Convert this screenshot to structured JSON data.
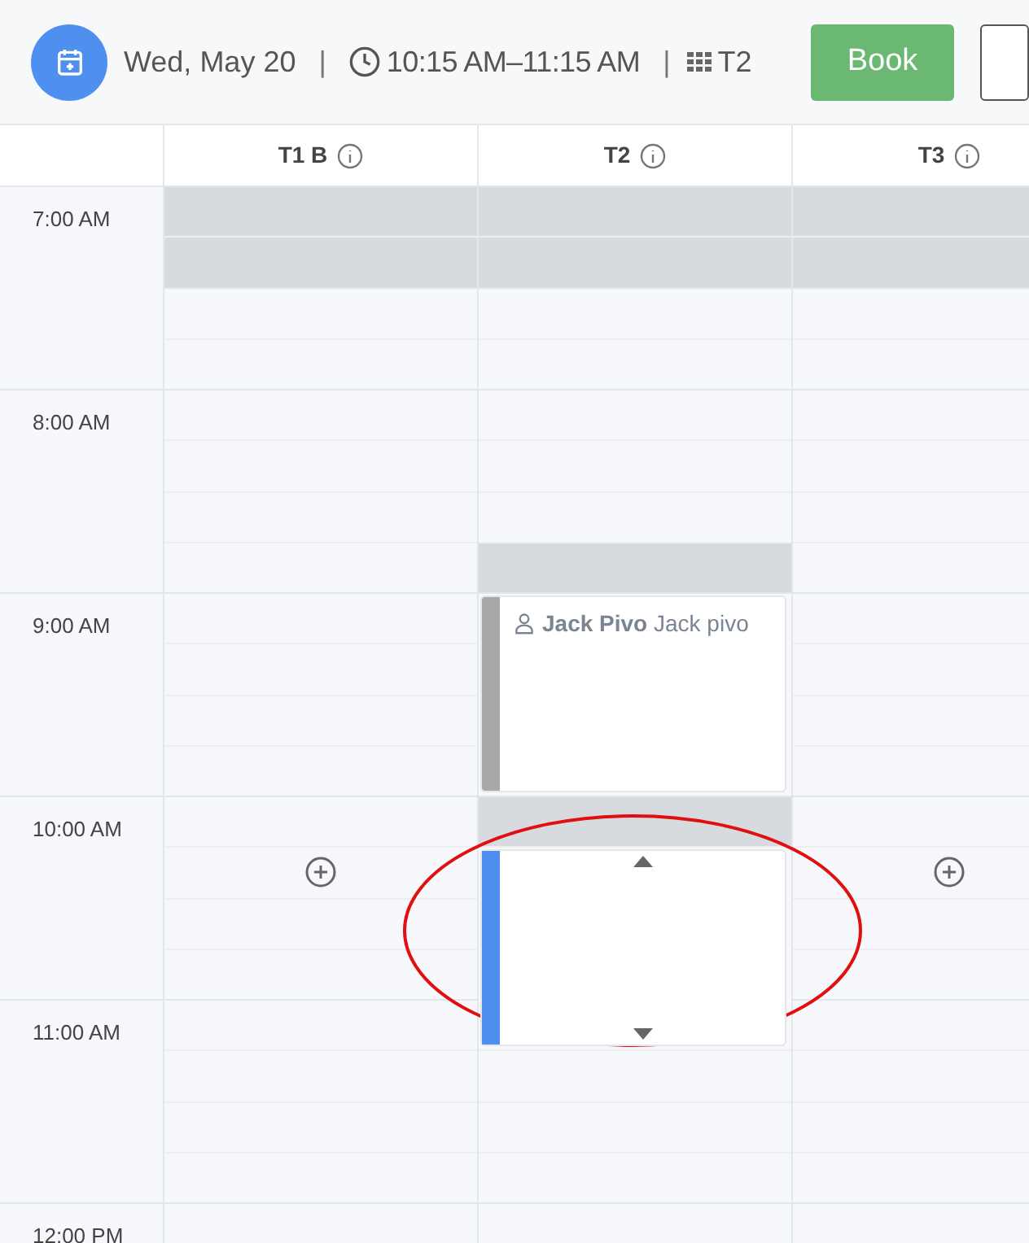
{
  "header": {
    "date": "Wed, May 20",
    "separator_1": "|",
    "time_range": "10:15 AM–11:15 AM",
    "separator_2": "|",
    "table": "T2",
    "book_button": "Book"
  },
  "hours": [
    "7:00 AM",
    "8:00 AM",
    "9:00 AM",
    "10:00 AM",
    "11:00 AM",
    "12:00 PM"
  ],
  "columns": [
    {
      "name": "T1 B",
      "slots": [
        {
          "kind": "blocked"
        },
        {
          "kind": "blocked"
        },
        {
          "kind": "free"
        },
        {
          "kind": "free"
        },
        {
          "kind": "free"
        },
        {
          "kind": "free"
        },
        {
          "kind": "free"
        },
        {
          "kind": "free"
        },
        {
          "kind": "free"
        },
        {
          "kind": "free"
        },
        {
          "kind": "free"
        },
        {
          "kind": "free"
        },
        {
          "kind": "free"
        },
        {
          "kind": "add"
        },
        {
          "kind": "free"
        },
        {
          "kind": "free"
        },
        {
          "kind": "free"
        },
        {
          "kind": "free"
        },
        {
          "kind": "free"
        },
        {
          "kind": "free"
        },
        {
          "kind": "free"
        }
      ]
    },
    {
      "name": "T2",
      "slots": [
        {
          "kind": "blocked"
        },
        {
          "kind": "blocked"
        },
        {
          "kind": "free"
        },
        {
          "kind": "free"
        },
        {
          "kind": "free"
        },
        {
          "kind": "free"
        },
        {
          "kind": "free"
        },
        {
          "kind": "blocked"
        },
        {
          "kind": "booked",
          "text": "**Jack Pivo** Jack pivo"
        },
        {
          "kind": "blocked"
        },
        {
          "kind": "new"
        },
        {
          "kind": "free"
        },
        {
          "kind": "free"
        },
        {
          "kind": "free"
        },
        {
          "kind": "free"
        }
      ]
    },
    {
      "name": "T3",
      "slots": [
        {
          "kind": "blocked"
        },
        {
          "kind": "blocked"
        },
        {
          "kind": "free"
        },
        {
          "kind": "free"
        },
        {
          "kind": "free"
        },
        {
          "kind": "free"
        },
        {
          "kind": "free"
        },
        {
          "kind": "free"
        },
        {
          "kind": "free"
        },
        {
          "kind": "free"
        },
        {
          "kind": "free"
        },
        {
          "kind": "free"
        },
        {
          "kind": "free"
        },
        {
          "kind": "add"
        },
        {
          "kind": "free"
        },
        {
          "kind": "free"
        },
        {
          "kind": "free"
        },
        {
          "kind": "free"
        },
        {
          "kind": "free"
        },
        {
          "kind": "free"
        },
        {
          "kind": "free"
        }
      ]
    }
  ]
}
